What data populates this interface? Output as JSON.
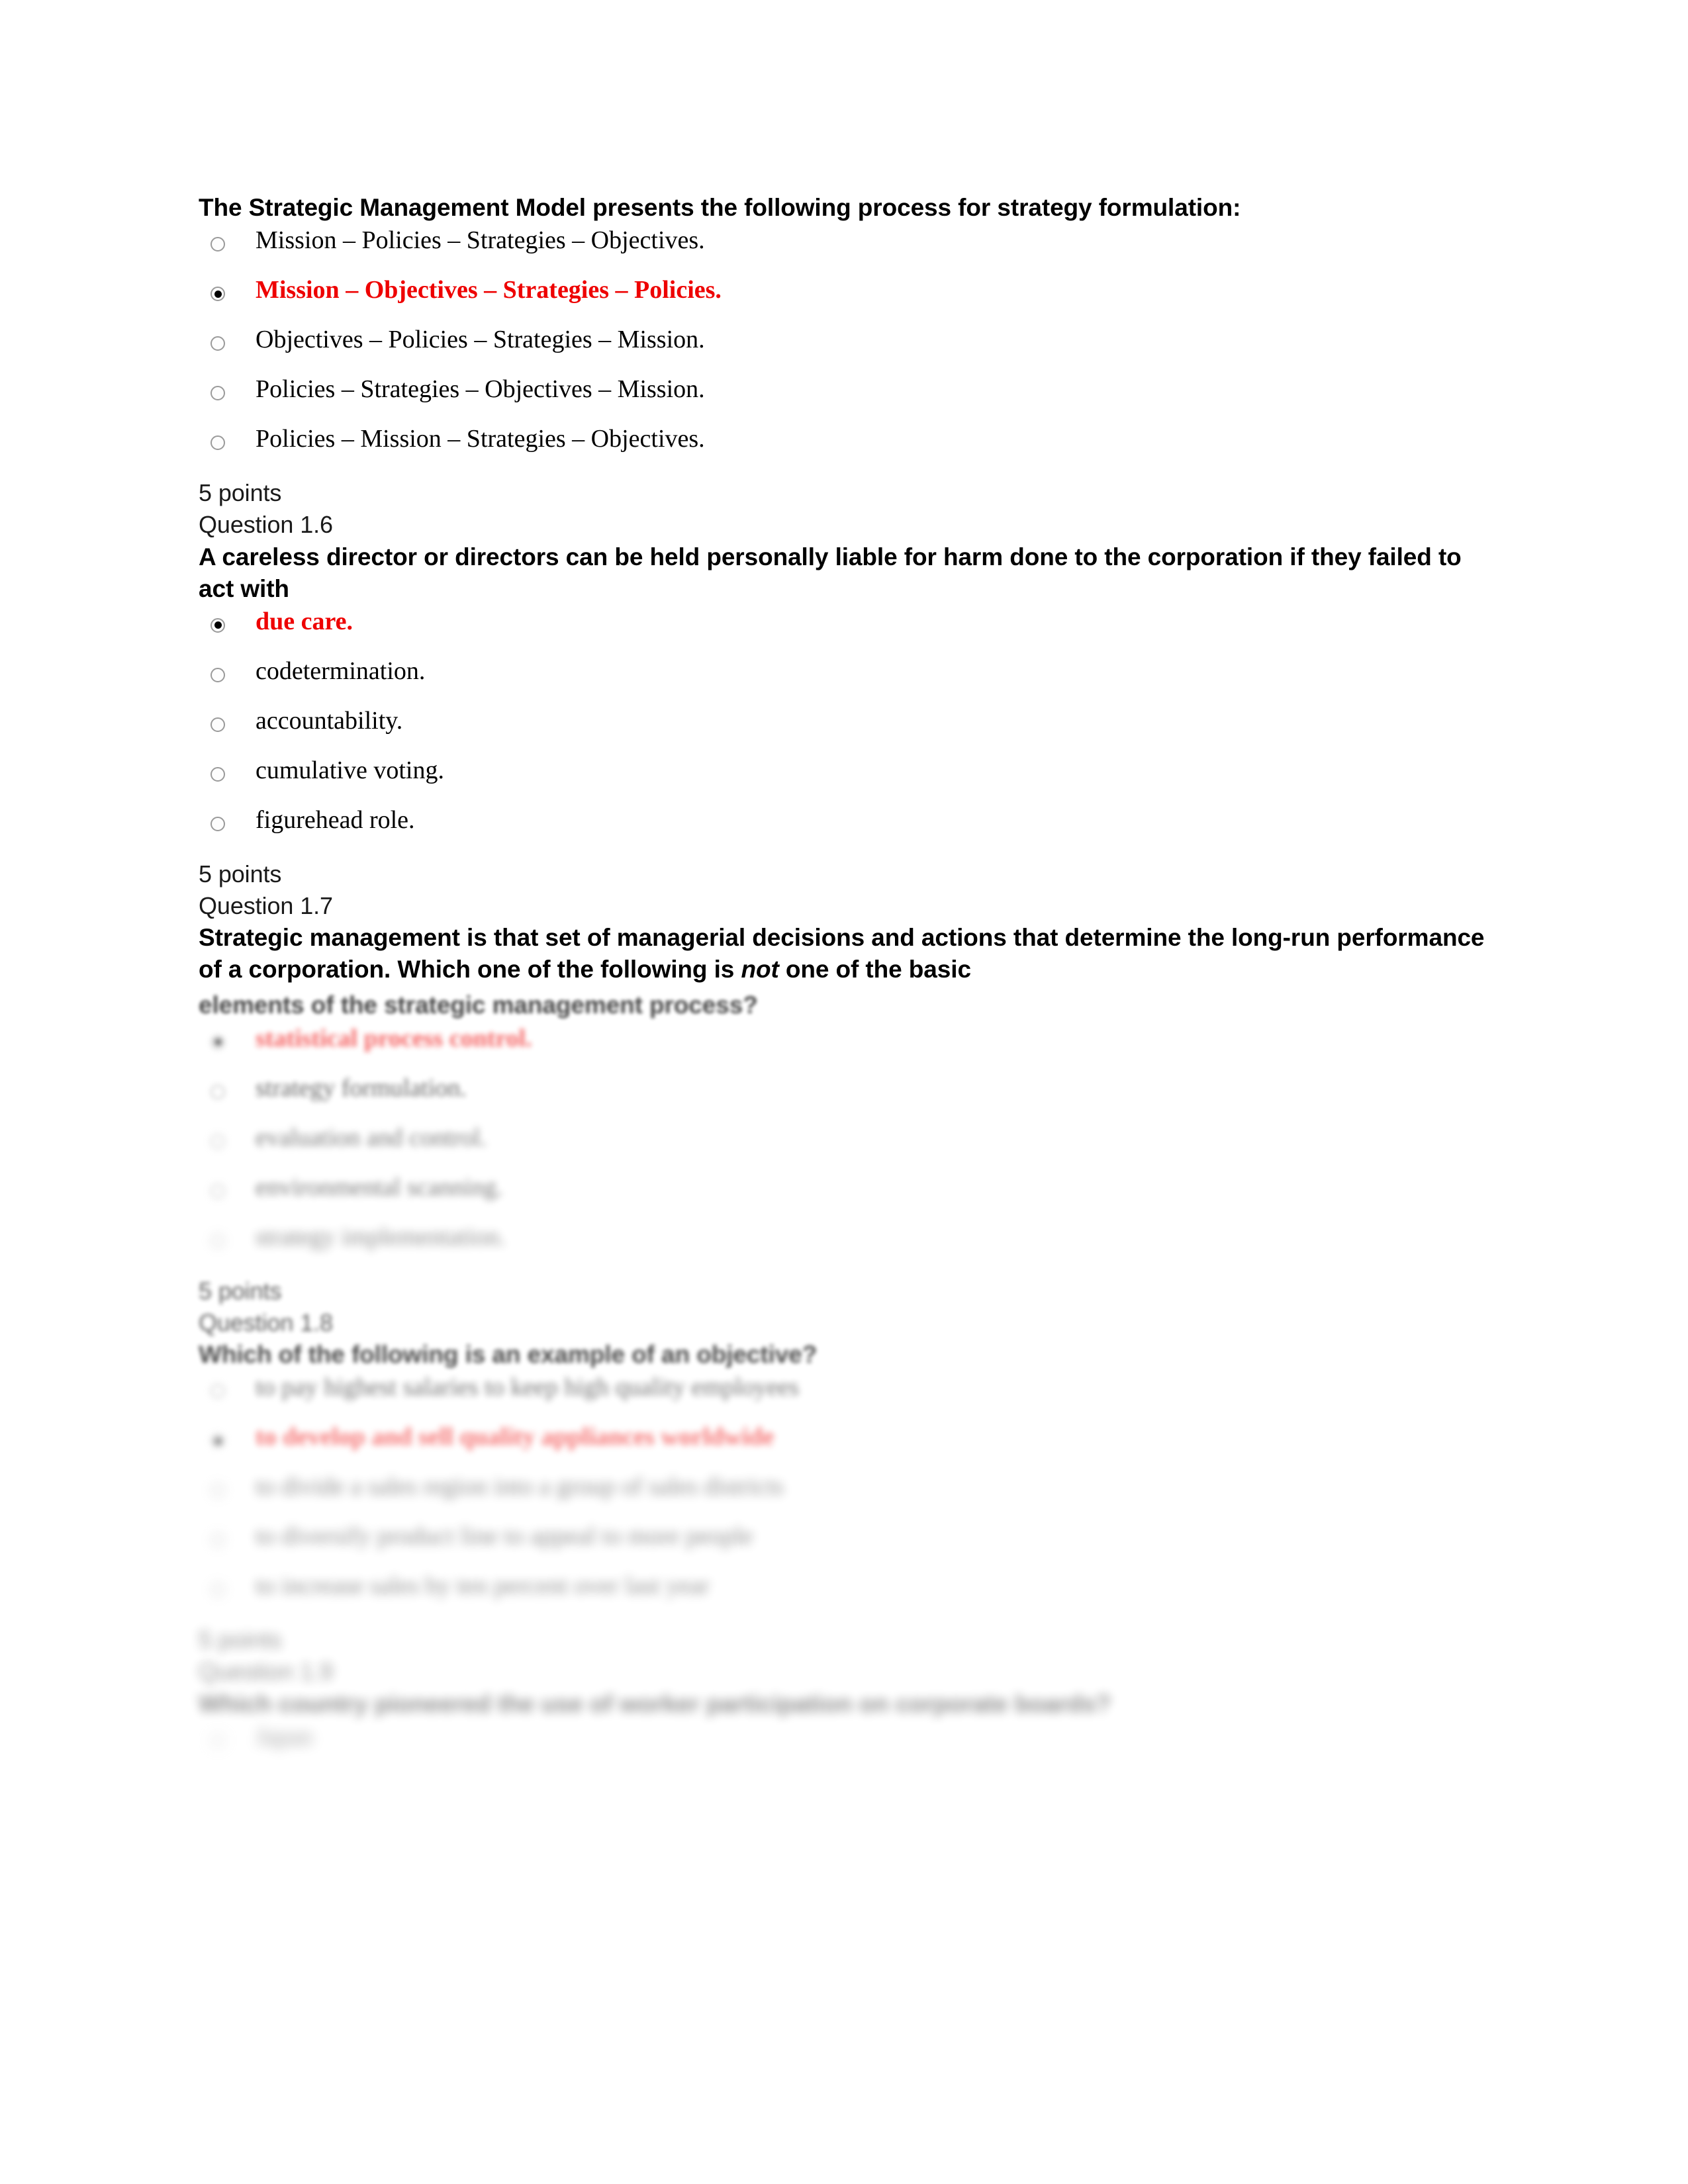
{
  "document": {
    "type": "online-quiz-printout",
    "accent_red": "#ee0000",
    "text_black": "#000000",
    "background": "#ffffff"
  },
  "questions": [
    {
      "id": "q1-5",
      "points_label": null,
      "number_label": null,
      "prompt": "The Strategic Management Model presents the following process for strategy formulation:",
      "prompt_italic_word": null,
      "blur": "none",
      "options": [
        {
          "text": "Mission – Policies – Strategies – Objectives.",
          "selected": false
        },
        {
          "text": "Mission – Objectives – Strategies – Policies.",
          "selected": true
        },
        {
          "text": "Objectives – Policies – Strategies – Mission.",
          "selected": false
        },
        {
          "text": "Policies – Strategies – Objectives – Mission.",
          "selected": false
        },
        {
          "text": "Policies – Mission – Strategies – Objectives.",
          "selected": false
        }
      ]
    },
    {
      "id": "q1-6",
      "points_label": "5 points",
      "number_label": "Question 1.6",
      "prompt": "A careless director or directors can be held personally liable for harm done to the corporation if they failed to act with",
      "prompt_italic_word": null,
      "blur": "none",
      "options": [
        {
          "text": "due care.",
          "selected": true
        },
        {
          "text": "codetermination.",
          "selected": false
        },
        {
          "text": "accountability.",
          "selected": false
        },
        {
          "text": "cumulative voting.",
          "selected": false
        },
        {
          "text": "figurehead role.",
          "selected": false
        }
      ]
    },
    {
      "id": "q1-7",
      "points_label": "5 points",
      "number_label": "Question 1.7",
      "prompt_part1": "Strategic management is that set of managerial decisions and actions that determine the long-run performance of a corporation. Which one of the following is ",
      "prompt_italic_word": "not",
      "prompt_part2": " one of the basic",
      "prompt_tail_blurred": "elements of the strategic management process?",
      "blur": "progressive",
      "options": [
        {
          "text": "statistical process control.",
          "selected": true
        },
        {
          "text": "strategy formulation.",
          "selected": false
        },
        {
          "text": "evaluation and control.",
          "selected": false
        },
        {
          "text": "environmental scanning.",
          "selected": false
        },
        {
          "text": "strategy implementation.",
          "selected": false
        }
      ]
    },
    {
      "id": "q1-8",
      "points_label": "5 points",
      "number_label": "Question 1.8",
      "prompt": "Which of the following is an example of an objective?",
      "prompt_italic_word": null,
      "blur": "heavy",
      "options": [
        {
          "text": "to pay highest salaries to keep high quality employees",
          "selected": false
        },
        {
          "text": "to develop and sell quality appliances worldwide",
          "selected": true
        },
        {
          "text": "to divide a sales region into a group of sales districts",
          "selected": false
        },
        {
          "text": "to diversify product line to appeal to more people",
          "selected": false
        },
        {
          "text": "to increase sales by ten percent over last year",
          "selected": false
        }
      ]
    },
    {
      "id": "q1-9",
      "points_label": "5 points",
      "number_label": "Question 1.9",
      "prompt": "Which country pioneered the use of worker participation on corporate boards?",
      "prompt_italic_word": null,
      "blur": "heavy",
      "options": [
        {
          "text": "Japan",
          "selected": false
        }
      ]
    }
  ]
}
